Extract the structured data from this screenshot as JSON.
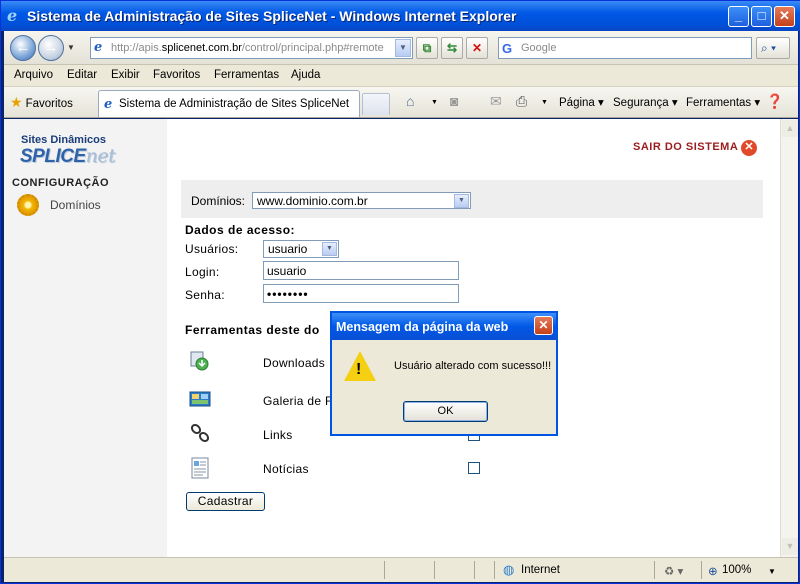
{
  "window": {
    "title": "Sistema de Administração de Sites SpliceNet - Windows Internet Explorer",
    "buttons": {
      "minimize": "_",
      "maximize": "□",
      "close": "✕"
    }
  },
  "navigation": {
    "url_prefix": "http://apis.",
    "url_domain": "splicenet.com.br",
    "url_path": "/control/principal.php#remote",
    "search_placeholder": "Google",
    "search_go": "⌕ ▾"
  },
  "menu": [
    "Arquivo",
    "Editar",
    "Exibir",
    "Favoritos",
    "Ferramentas",
    "Ajuda"
  ],
  "favorites_bar": {
    "favorites_label": "Favoritos",
    "tab_title": "Sistema de Administração de Sites SpliceNet",
    "commands": {
      "pagina": "Página",
      "seguranca": "Segurança",
      "ferramentas": "Ferramentas"
    }
  },
  "sidebar": {
    "logo_top": "Sites Dinâmicos",
    "logo_splice": "SPLICE",
    "logo_net": "net",
    "section": "CONFIGURAÇÃO",
    "items": [
      {
        "label": "Domínios",
        "icon": "gear-icon"
      }
    ]
  },
  "main": {
    "logout": "SAIR DO SISTEMA",
    "domain_label": "Domínios:",
    "domain_selected": "www.dominio.com.br",
    "access_heading": "Dados de acesso:",
    "users_label": "Usuários:",
    "users_selected": "usuario",
    "login_label": "Login:",
    "login_value": "usuario",
    "password_label": "Senha:",
    "password_value": "••••••••",
    "tools_heading": "Ferramentas deste do",
    "tools": [
      {
        "label": "Downloads",
        "icon": "downloads-icon"
      },
      {
        "label": "Galeria de F",
        "icon": "gallery-icon"
      },
      {
        "label": "Links",
        "icon": "links-icon"
      },
      {
        "label": "Notícias",
        "icon": "news-icon"
      }
    ],
    "submit": "Cadastrar"
  },
  "dialog": {
    "title": "Mensagem da página da web",
    "message": "Usuário alterado com sucesso!!!",
    "ok": "OK"
  },
  "status": {
    "zone": "Internet",
    "zoom": "100%"
  },
  "colors": {
    "titlebar": "#0058e6",
    "logout_text": "#9a1c1c",
    "logout_icon": "#e04a2b",
    "warning": "#f5cf12"
  }
}
